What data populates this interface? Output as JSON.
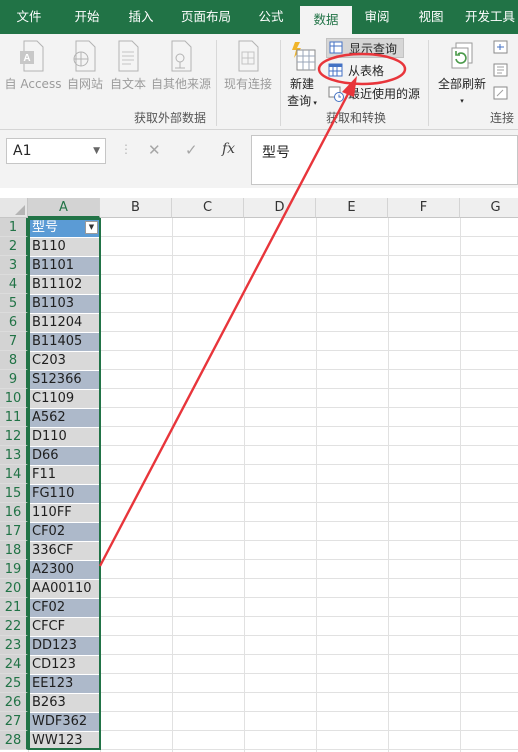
{
  "tabs": [
    "文件",
    "开始",
    "插入",
    "页面布局",
    "公式",
    "数据",
    "审阅",
    "视图",
    "开发工具"
  ],
  "active_tab": "数据",
  "ribbon": {
    "get_external": {
      "access": "自 Access",
      "web": "自网站",
      "text": "自文本",
      "other": "自其他来源",
      "existing": "现有连接",
      "label": "获取外部数据"
    },
    "get_transform": {
      "new_query_line1": "新建",
      "new_query_line2": "查询",
      "show_queries": "显示查询",
      "from_table": "从表格",
      "recent_sources": "最近使用的源",
      "label": "获取和转换"
    },
    "connections": {
      "refresh_all": "全部刷新",
      "label": "连接"
    }
  },
  "formula_bar": {
    "name_box": "A1",
    "cancel": "✕",
    "enter": "✓",
    "fx": "fx",
    "content": "型号"
  },
  "columns": [
    "A",
    "B",
    "C",
    "D",
    "E",
    "F",
    "G"
  ],
  "selected_column": "A",
  "rows": [
    "1",
    "2",
    "3",
    "4",
    "5",
    "6",
    "7",
    "8",
    "9",
    "10",
    "11",
    "12",
    "13",
    "14",
    "15",
    "16",
    "17",
    "18",
    "19",
    "20",
    "21",
    "22",
    "23",
    "24",
    "25",
    "26",
    "27",
    "28"
  ],
  "column_a": [
    "型号",
    "B110",
    "B1101",
    "B11102",
    "B1103",
    "B11204",
    "B11405",
    "C203",
    "S12366",
    "C1109",
    "A562",
    "D110",
    "D66",
    "F11",
    "FG110",
    "110FF",
    "CF02",
    "336CF",
    "A2300",
    "AA00110",
    "CF02",
    "CFCF",
    "DD123",
    "CD123",
    "EE123",
    "B263",
    "WDF362",
    "WW123"
  ],
  "colors": {
    "excel_green": "#217346",
    "table_header": "#5b9bd5",
    "band_light": "#d9d9d9",
    "band_dark": "#adb9ca",
    "annotation_red": "#e8353b"
  }
}
